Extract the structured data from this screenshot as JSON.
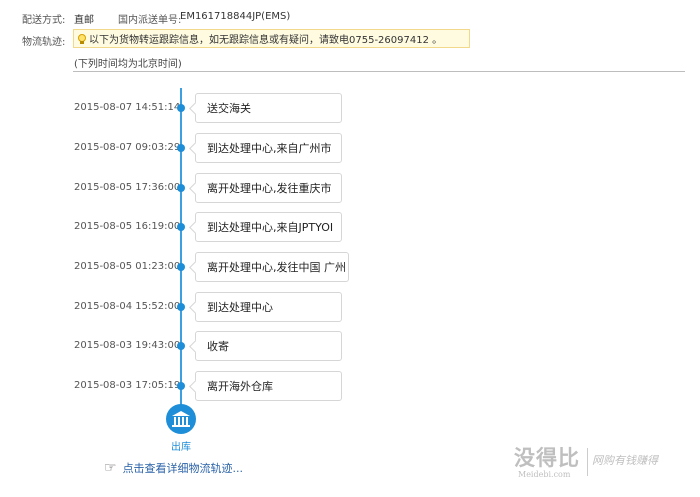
{
  "shipping": {
    "method_label": "配送方式:",
    "method_value": "直邮",
    "tracking_label": "国内派送单号:",
    "tracking_value": "EM161718844JP(EMS)"
  },
  "logistics": {
    "label": "物流轨迹:",
    "notice": "以下为货物转运跟踪信息，如无跟踪信息或有疑问，请致电0755-26097412 。",
    "timezone_note": "(下列时间均为北京时间)"
  },
  "timeline": [
    {
      "time": "2015-08-07 14:51:14",
      "event": "送交海关"
    },
    {
      "time": "2015-08-07 09:03:29",
      "event": "到达处理中心,来自广州市"
    },
    {
      "time": "2015-08-05 17:36:00",
      "event": "离开处理中心,发往重庆市"
    },
    {
      "time": "2015-08-05 16:19:00",
      "event": "到达处理中心,来自JPTYOI"
    },
    {
      "time": "2015-08-05 01:23:00",
      "event": "离开处理中心,发往中国 广州"
    },
    {
      "time": "2015-08-04 15:52:00",
      "event": "到达处理中心"
    },
    {
      "time": "2015-08-03 19:43:00",
      "event": "收寄"
    },
    {
      "time": "2015-08-03 17:05:19",
      "event": "离开海外仓库"
    }
  ],
  "end_node": {
    "label": "出库",
    "icon": "warehouse-icon"
  },
  "detail_link": "点击查看详细物流轨迹...",
  "watermark": {
    "main": "没得比",
    "sub": "Meidebi.com",
    "slogan": "网购有钱赚得"
  },
  "colors": {
    "accent": "#1e8ed8",
    "link": "#2a62a8",
    "notice_bg": "#fffbe0"
  }
}
